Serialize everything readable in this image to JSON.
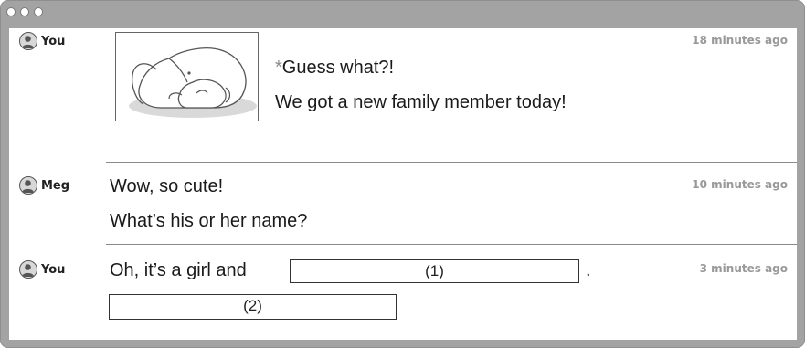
{
  "window": {
    "controls": [
      "close-dot",
      "minimize-dot",
      "zoom-dot"
    ]
  },
  "messages": [
    {
      "user": "You",
      "time": "18 minutes ago",
      "image": "sleeping-dog-and-puppy-illustration",
      "lines": [
        "Guess what?!",
        "We got a new family member today!"
      ],
      "marker": "*"
    },
    {
      "user": "Meg",
      "time": "10 minutes ago",
      "lines": [
        "Wow, so cute!",
        "What’s his or her name?"
      ]
    },
    {
      "user": "You",
      "time": "3 minutes ago",
      "lines": [
        "Oh, it’s a girl and"
      ],
      "blanks": [
        "(1)",
        "(2)"
      ],
      "after_blank_1": "."
    }
  ]
}
